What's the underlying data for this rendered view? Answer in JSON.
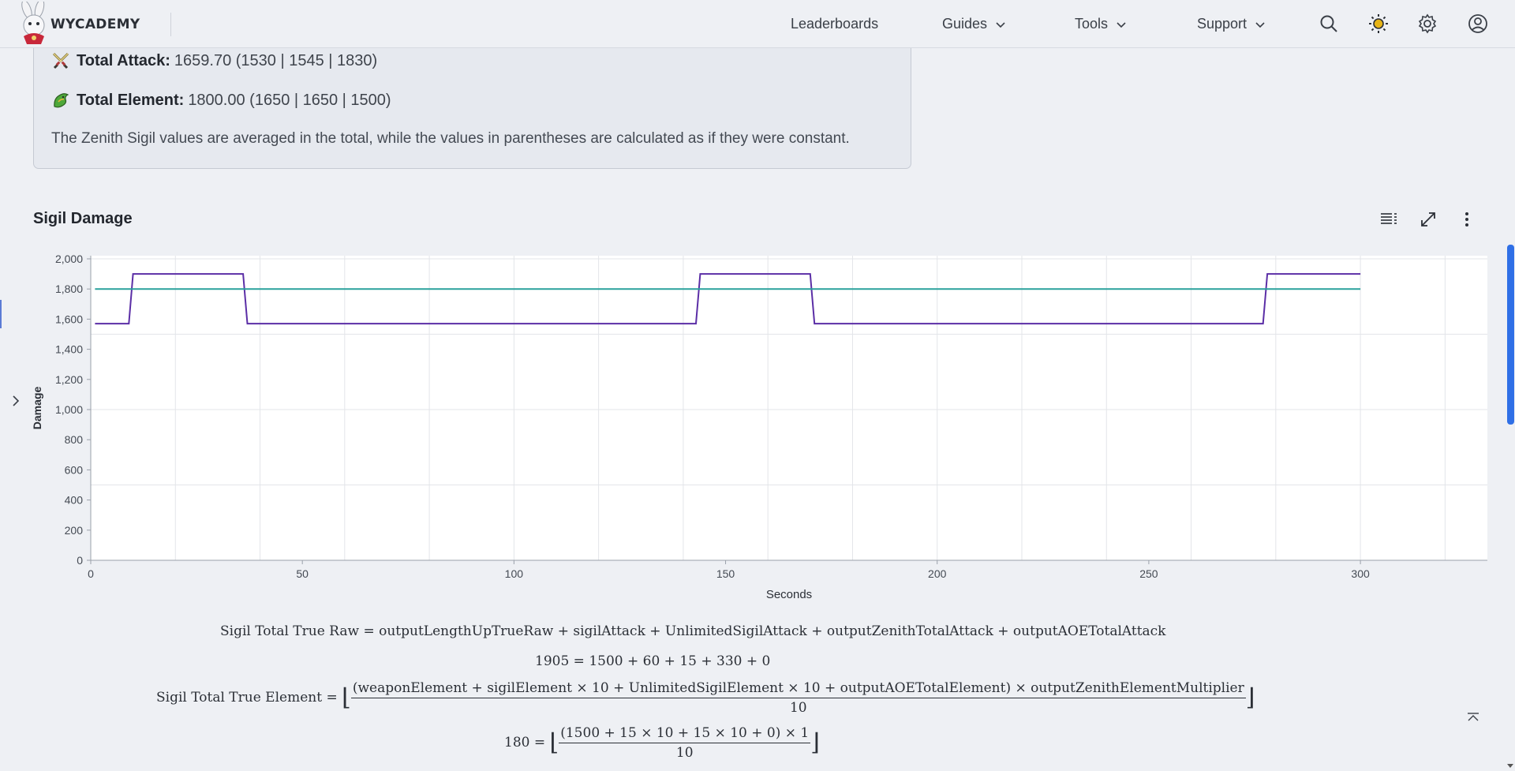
{
  "header": {
    "logo_text": "WYCADEMY",
    "nav": [
      {
        "label": "Leaderboards",
        "dropdown": false
      },
      {
        "label": "Guides",
        "dropdown": true
      },
      {
        "label": "Tools",
        "dropdown": true
      },
      {
        "label": "Support",
        "dropdown": true
      }
    ],
    "icons": [
      "search-icon",
      "theme-sun-icon",
      "settings-gear-icon",
      "account-icon"
    ]
  },
  "stats": {
    "attack_label": "Total Attack:",
    "attack_value": "1659.70 (1530 | 1545 | 1830)",
    "element_label": "Total Element:",
    "element_value": "1800.00 (1650 | 1650 | 1500)",
    "note": "The Zenith Sigil values are averaged in the total, while the values in parentheses are calculated as if they were constant."
  },
  "chart_section": {
    "title": "Sigil Damage",
    "tools": [
      "list-view-icon",
      "expand-icon",
      "more-options-icon"
    ]
  },
  "chart_data": {
    "type": "line",
    "title": "",
    "xlabel": "Seconds",
    "ylabel": "Damage",
    "xlim": [
      0,
      330
    ],
    "ylim": [
      0,
      2000
    ],
    "x_ticks": [
      0,
      50,
      100,
      150,
      200,
      250,
      300
    ],
    "y_ticks": [
      0,
      200,
      400,
      600,
      800,
      1000,
      1200,
      1400,
      1600,
      1800,
      2000
    ],
    "x_tick_labels": [
      "0",
      "50",
      "100",
      "150",
      "200",
      "250",
      "300"
    ],
    "y_tick_labels": [
      "0",
      "200",
      "400",
      "600",
      "800",
      "1,000",
      "1,200",
      "1,400",
      "1,600",
      "1,800",
      "2,000"
    ],
    "grid": true,
    "series": [
      {
        "color": "#5b2ea6",
        "x": [
          1,
          9,
          10,
          36,
          37,
          143,
          144,
          170,
          171,
          277,
          278,
          300
        ],
        "y": [
          1570,
          1570,
          1900,
          1900,
          1570,
          1570,
          1900,
          1900,
          1570,
          1570,
          1900,
          1900
        ]
      },
      {
        "color": "#2aa19c",
        "x": [
          1,
          300
        ],
        "y": [
          1800,
          1800
        ]
      }
    ]
  },
  "formulas": {
    "raw_formula": "Sigil Total True Raw = outputLengthUpTrueRaw + sigilAttack + UnlimitedSigilAttack + outputZenithTotalAttack + outputAOETotalAttack",
    "raw_result": "1905 = 1500 + 60 + 15 + 330 + 0",
    "element_lhs": "Sigil Total True Element =",
    "element_num": "(weaponElement + sigilElement × 10 + UnlimitedSigilElement × 10 + outputAOETotalElement) × outputZenithElementMultiplier",
    "element_den": "10",
    "element_result_lhs": "180 =",
    "element_result_num": "(1500 + 15 × 10 + 15 × 10 + 0) × 1",
    "element_result_den": "10"
  }
}
